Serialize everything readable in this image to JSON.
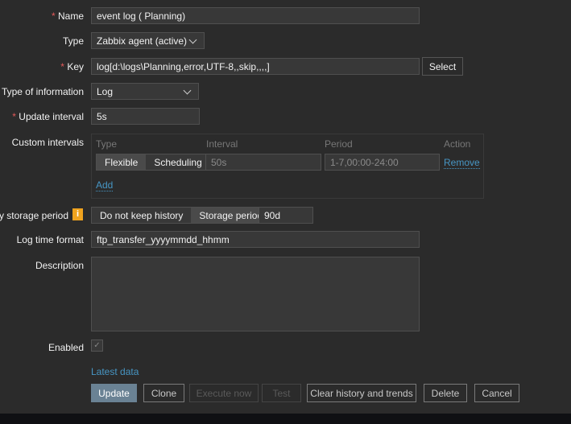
{
  "form": {
    "name": {
      "label": "Name",
      "value": "event log ( Planning)"
    },
    "type": {
      "label": "Type",
      "value": "Zabbix agent (active)"
    },
    "key": {
      "label": "Key",
      "value": "log[d:\\logs\\Planning,error,UTF-8,,skip,,,,]",
      "select_label": "Select"
    },
    "type_of_information": {
      "label": "Type of information",
      "value": "Log"
    },
    "update_interval": {
      "label": "Update interval",
      "value": "5s"
    },
    "custom_intervals": {
      "label": "Custom intervals",
      "headers": [
        "Type",
        "Interval",
        "Period",
        "Action"
      ],
      "row": {
        "type_options": [
          "Flexible",
          "Scheduling"
        ],
        "interval": "50s",
        "period": "1-7,00:00-24:00",
        "action": "Remove"
      },
      "add_label": "Add"
    },
    "history": {
      "label": "History storage period",
      "options": [
        "Do not keep history",
        "Storage period"
      ],
      "value": "90d"
    },
    "log_time_format": {
      "label": "Log time format",
      "value": "ftp_transfer_yyyymmdd_hhmm"
    },
    "description": {
      "label": "Description",
      "value": ""
    },
    "enabled": {
      "label": "Enabled",
      "checked": true
    },
    "latest_data": "Latest data"
  },
  "buttons": {
    "update": "Update",
    "clone": "Clone",
    "execute_now": "Execute now",
    "test": "Test",
    "clear": "Clear history and trends",
    "delete": "Delete",
    "cancel": "Cancel"
  }
}
